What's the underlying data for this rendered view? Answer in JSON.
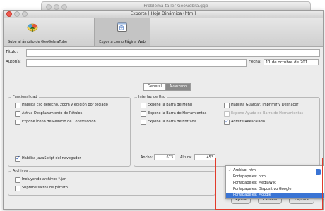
{
  "background_window": {
    "title": "Problema taller GeoGebra.ggb"
  },
  "dialog": {
    "title": "Exporta | Hoja Dinámica (html)",
    "toolbar": [
      {
        "label": "Sube al ámbito de GeoGebraTube",
        "icon": "upload-cloud-icon"
      },
      {
        "label": "Exporta como Página Web",
        "icon": "webpage-icon"
      }
    ],
    "title_label": "Título:",
    "title_value": "",
    "author_label": "Autoría:",
    "author_value": "",
    "date_label": "Fecha:",
    "date_value": "11 de octubre de 201",
    "tabs": [
      "General",
      "Avanzado"
    ],
    "functionality_legend": "Funcionalidad",
    "functionality_items": [
      {
        "label": "Habilita clic derecho, zoom y edición por teclado",
        "checked": false
      },
      {
        "label": "Activa Desplazamiento de Rótulos",
        "checked": false
      },
      {
        "label": "Expone Ícono de Reinicio de Construcción",
        "checked": false
      }
    ],
    "interface_legend": "Interfaz de Uso",
    "interface_items": [
      {
        "label": "Expone la Barra de Menú",
        "checked": false
      },
      {
        "label": "Expone la Barra de Herramientas",
        "checked": false
      },
      {
        "label": "Expone la Barra de Entrada",
        "checked": false
      }
    ],
    "interface_items_right": [
      {
        "label": "Habilita Guardar, Imprimir y Deshacer",
        "checked": false,
        "dim": false
      },
      {
        "label": "Expone Ayuda de Barra de Herramientas",
        "checked": false,
        "dim": true
      },
      {
        "label": "Admite Reescalado",
        "checked": true,
        "dim": false
      }
    ],
    "browser_label": "Habilita JavaScript del navegador",
    "browser_checked": true,
    "width_label": "Ancho:",
    "width_value": "673",
    "height_label": "Altura:",
    "height_value": "453",
    "files_legend": "Archivos",
    "files_items": [
      {
        "label": "Incluyendo archivos *.jar",
        "checked": false
      },
      {
        "label": "Suprime saltos de párrafo",
        "checked": false
      }
    ],
    "export_menu": [
      {
        "label": "Archivo: html",
        "checked": true,
        "highlighted": false
      },
      {
        "label": "Portapapeles: html",
        "checked": false,
        "highlighted": false
      },
      {
        "label": "Portapapeles: MediaWiki",
        "checked": false,
        "highlighted": false
      },
      {
        "label": "Portapapeles: Dispositivo Google",
        "checked": false,
        "highlighted": false
      },
      {
        "label": "Portapapeles: Moodle",
        "checked": false,
        "highlighted": true
      }
    ],
    "footer_buttons": [
      "Ayuda",
      "Cancela",
      "Exporta"
    ],
    "colors": {
      "highlight": "#3a74d4",
      "annotation": "#e23b2b"
    }
  }
}
